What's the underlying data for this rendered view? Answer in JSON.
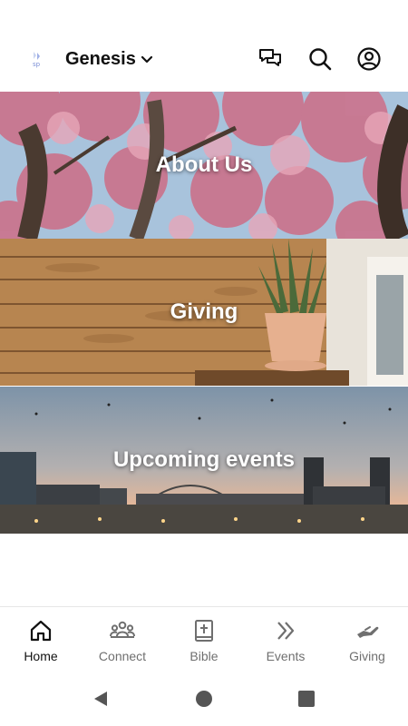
{
  "header": {
    "church_name": "Genesis",
    "logo_icon": "church-logo-icon",
    "icons": [
      "chat-icon",
      "search-icon",
      "account-icon"
    ]
  },
  "tiles": [
    {
      "label": "About Us"
    },
    {
      "label": "Giving"
    },
    {
      "label": "Upcoming events"
    }
  ],
  "bottom_nav": {
    "items": [
      {
        "label": "Home",
        "icon": "home-icon",
        "active": true
      },
      {
        "label": "Connect",
        "icon": "group-icon",
        "active": false
      },
      {
        "label": "Bible",
        "icon": "bible-icon",
        "active": false
      },
      {
        "label": "Events",
        "icon": "double-chevron-icon",
        "active": false
      },
      {
        "label": "Giving",
        "icon": "giving-hand-icon",
        "active": false
      }
    ]
  },
  "system_nav": [
    "back-triangle-icon",
    "home-circle-icon",
    "recents-square-icon"
  ],
  "colors": {
    "active": "#111111",
    "inactive": "#6f6f6f",
    "accent_logo": "#7b8fd6"
  }
}
